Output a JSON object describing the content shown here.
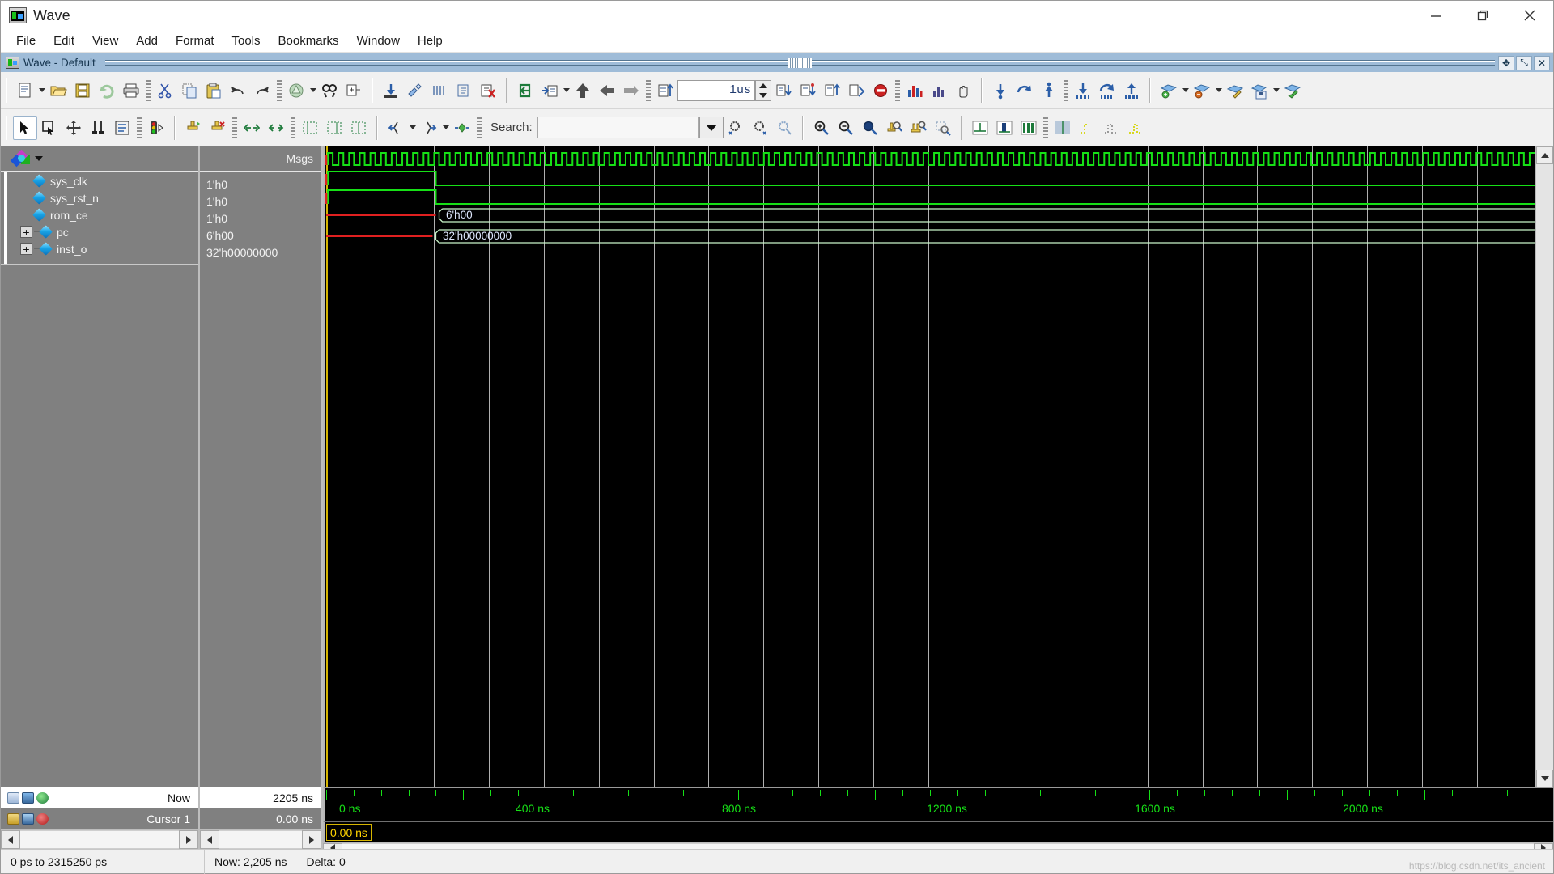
{
  "window": {
    "title": "Wave",
    "icon": "wave-app-icon",
    "minimize_label": "—",
    "maximize_label": "❐",
    "close_label": "✕"
  },
  "menubar": {
    "items": [
      {
        "label": "File"
      },
      {
        "label": "Edit"
      },
      {
        "label": "View"
      },
      {
        "label": "Add"
      },
      {
        "label": "Format"
      },
      {
        "label": "Tools"
      },
      {
        "label": "Bookmarks"
      },
      {
        "label": "Window"
      },
      {
        "label": "Help"
      }
    ]
  },
  "pane": {
    "title": "Wave - Default",
    "buttons": [
      {
        "name": "undock-button",
        "glyph": "✥"
      },
      {
        "name": "restore-button",
        "glyph": "⤡"
      },
      {
        "name": "close-pane-button",
        "glyph": "✕"
      }
    ]
  },
  "toolbar_run": {
    "run_length_value": "1us",
    "run_length_placeholder": "1us"
  },
  "toolbar_search": {
    "label": "Search:",
    "value": "",
    "placeholder": ""
  },
  "columns": {
    "name_header": "",
    "value_header": "Msgs"
  },
  "signals": [
    {
      "name": "sys_clk",
      "value": "1'h0",
      "expandable": false,
      "type": "wire"
    },
    {
      "name": "sys_rst_n",
      "value": "1'h0",
      "expandable": false,
      "type": "wire"
    },
    {
      "name": "rom_ce",
      "value": "1'h0",
      "expandable": false,
      "type": "wire"
    },
    {
      "name": "pc",
      "value": "6'h00",
      "expandable": true,
      "type": "bus"
    },
    {
      "name": "inst_o",
      "value": "32'h00000000",
      "expandable": true,
      "type": "bus"
    }
  ],
  "wave_data": {
    "bus_labels": [
      {
        "signal": "pc",
        "text": "6'h00"
      },
      {
        "signal": "inst_o",
        "text": "32'h00000000"
      }
    ],
    "colors": {
      "signal_green": "#16e016",
      "undefined_red": "#e02020",
      "cursor_yellow": "#d6b500",
      "grid": "#b0b0b0",
      "background": "#000000"
    }
  },
  "ruler": {
    "labels": [
      "0 ns",
      "400 ns",
      "800 ns",
      "1200 ns",
      "1600 ns",
      "2000 ns"
    ],
    "values_ns": [
      0,
      400,
      800,
      1200,
      1600,
      2000
    ],
    "unit": "ns",
    "range_start_ns": 0,
    "range_end_ns": 2315.25
  },
  "cursor_panel": {
    "now_label": "Now",
    "now_value": "2205 ns",
    "cursor_label": "Cursor 1",
    "cursor_value": "0.00 ns",
    "cursor_tag": "0.00 ns"
  },
  "statusbar": {
    "range_text": "0 ps to 2315250 ps",
    "now_text": "Now: 2,205 ns",
    "delta_text": "Delta: 0",
    "watermark": "https://blog.csdn.net/its_ancient"
  }
}
